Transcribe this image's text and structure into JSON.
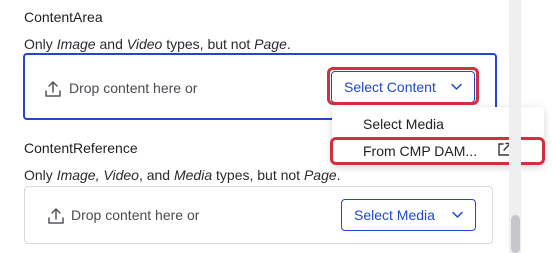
{
  "content_area": {
    "label": "ContentArea",
    "help": {
      "p1": "Only ",
      "e1": "Image",
      "p2": " and ",
      "e2": "Video",
      "p3": " types, but not ",
      "e3": "Page",
      "p4": "."
    },
    "drop_text": "Drop content here or",
    "button_label": "Select Content",
    "menu": {
      "items": [
        "Select Media",
        "From CMP DAM..."
      ]
    }
  },
  "content_reference": {
    "label": "ContentReference",
    "help": {
      "p1": "Only ",
      "e1": "Image,",
      "p2": " ",
      "e2": "Video",
      "p3": ", and ",
      "e3": "Media",
      "p4": " types, but not ",
      "e4": "Page",
      "p5": "."
    },
    "drop_text": "Drop content here or",
    "button_label": "Select Media"
  },
  "colors": {
    "accent": "#1f49c8",
    "highlight": "#d2303f"
  },
  "icons": [
    "upload-icon",
    "chevron-down-icon",
    "external-link-icon"
  ]
}
